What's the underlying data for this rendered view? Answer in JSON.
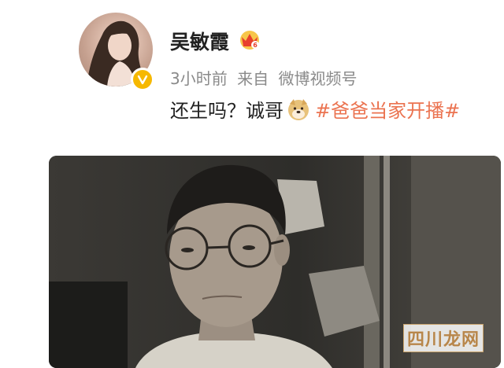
{
  "post": {
    "username": "吴敏霞",
    "time_ago": "3小时前",
    "source_prefix": "来自",
    "source": "微博视频号",
    "text": "还生吗？诚哥",
    "hashtag": "#爸爸当家开播#"
  },
  "icons": {
    "crown": "crown-icon",
    "verified": "verified-icon",
    "emoji": "doge-emoji-icon"
  },
  "colors": {
    "hashtag": "#eb7350",
    "verified": "#f6b800",
    "crown": "#f2a218"
  },
  "watermark": {
    "text": "四川龙网"
  }
}
